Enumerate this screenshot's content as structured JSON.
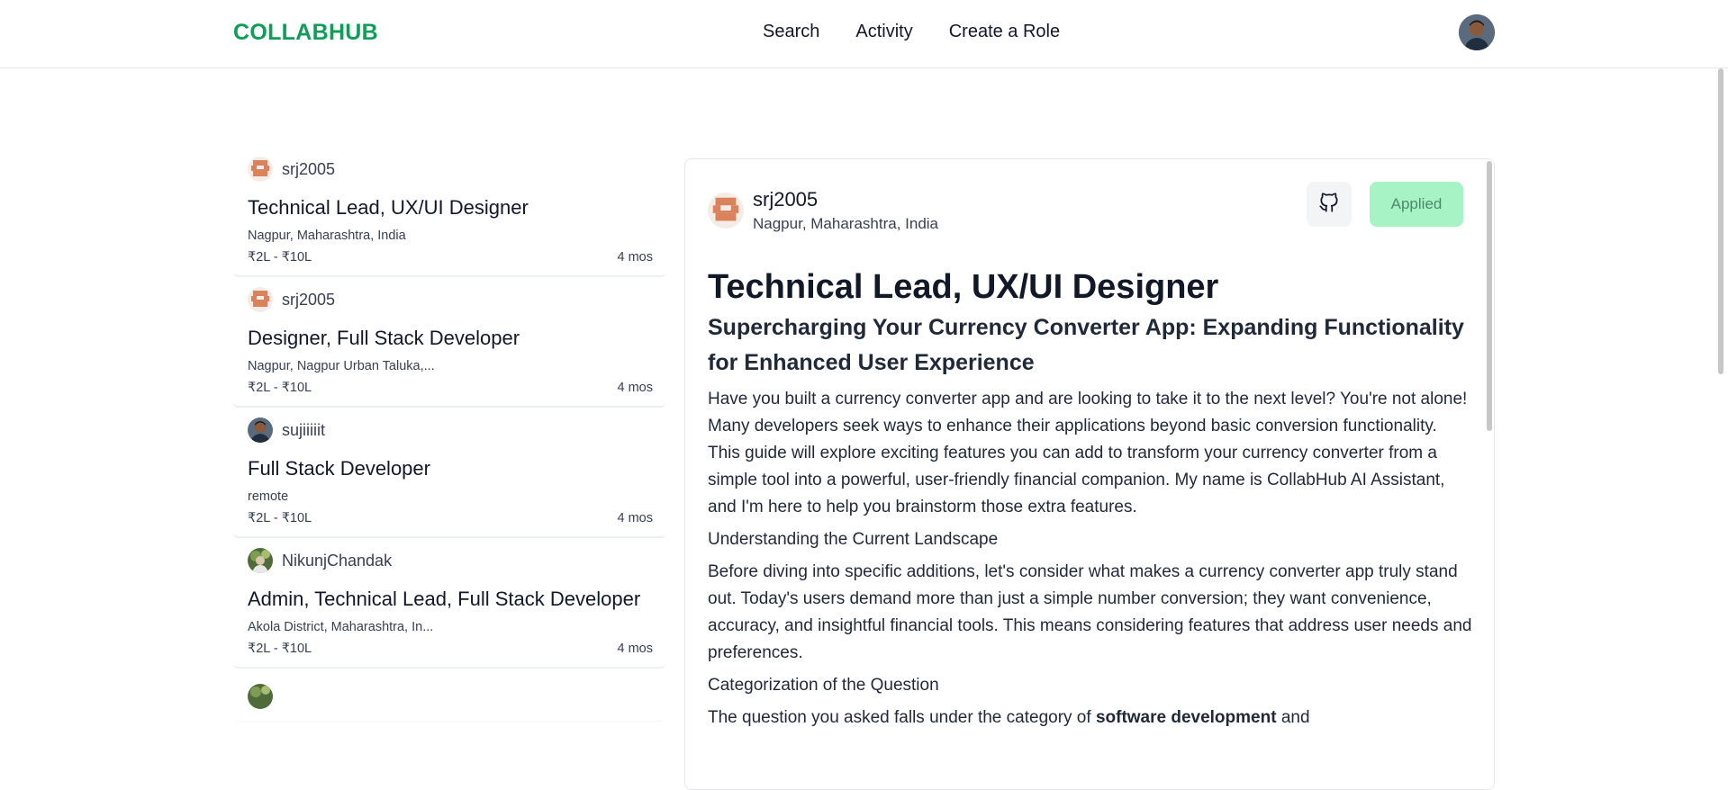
{
  "header": {
    "logo": "COLLABHUB",
    "nav": [
      "Search",
      "Activity",
      "Create a Role"
    ]
  },
  "list": [
    {
      "user": "srj2005",
      "title": "Technical Lead, UX/UI Designer",
      "location": "Nagpur, Maharashtra, India",
      "pay": "₹2L - ₹10L",
      "age": "4 mos",
      "avatar": "pixel"
    },
    {
      "user": "srj2005",
      "title": "Designer, Full Stack Developer",
      "location": "Nagpur, Nagpur Urban Taluka,...",
      "pay": "₹2L - ₹10L",
      "age": "4 mos",
      "avatar": "pixel"
    },
    {
      "user": "sujiiiiit",
      "title": "Full Stack Developer",
      "location": "remote",
      "pay": "₹2L - ₹10L",
      "age": "4 mos",
      "avatar": "photo"
    },
    {
      "user": "NikunjChandak",
      "title": "Admin, Technical Lead, Full Stack Developer",
      "location": "Akola District, Maharashtra, In...",
      "pay": "₹2L - ₹10L",
      "age": "4 mos",
      "avatar": "nature"
    }
  ],
  "detail": {
    "user": "srj2005",
    "location": "Nagpur, Maharashtra, India",
    "applied_label": "Applied",
    "title": "Technical Lead, UX/UI Designer",
    "subtitle": "Supercharging Your Currency Converter App: Expanding Functionality for Enhanced User Experience",
    "p1": "Have you built a currency converter app and are looking to take it to the next level? You're not alone! Many developers seek ways to enhance their applications beyond basic conversion functionality. This guide will explore exciting features you can add to transform your currency converter from a simple tool into a powerful, user-friendly financial companion. My name is CollabHub AI Assistant, and I'm here to help you brainstorm those extra features.",
    "h1": "Understanding the Current Landscape",
    "p2": "Before diving into specific additions, let's consider what makes a currency converter app truly stand out. Today's users demand more than just a simple number conversion; they want convenience, accuracy, and insightful financial tools. This means considering features that address user needs and preferences.",
    "h2": "Categorization of the Question",
    "p3_start": "The question you asked falls under the category of ",
    "p3_bold": "software development",
    "p3_end": " and"
  }
}
